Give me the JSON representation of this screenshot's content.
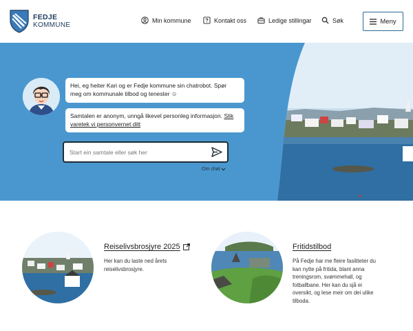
{
  "header": {
    "logo_name": "FEDJE",
    "logo_sub": "KOMMUNE",
    "nav": [
      {
        "label": "Min kommune",
        "icon": "user-circle-icon"
      },
      {
        "label": "Kontakt oss",
        "icon": "question-square-icon"
      },
      {
        "label": "Ledige stillingar",
        "icon": "briefcase-icon"
      },
      {
        "label": "Søk",
        "icon": "search-icon"
      }
    ],
    "menu_label": "Meny"
  },
  "chat": {
    "message_1": "Hei, eg heiter Kari og er Fedje kommune sin chatrobot. Spør meg om kommunale tilbod og tenester ☺",
    "message_2_text": "Samtalen er anonym, unngå likevel personleg informasjon. ",
    "message_2_link": "Slik varetek vi personvernet ditt",
    "input_placeholder": "Start ein samtale eller søk her",
    "about_label": "Om chat"
  },
  "cards": [
    {
      "title": "Reiselivsbrosjyre 2025",
      "external": true,
      "description": "Her kan du laste ned årets reiselivsbrosjyre."
    },
    {
      "title": "Fritidstilbod",
      "external": false,
      "description": "På Fedje har me fleire fasiliteter du kan nytte på fritida, blant anna treningsrom, svømmehall, og fotballbane. Her kan du sjå ei oversikt, og lese meir om dei ulike tilboda."
    }
  ],
  "colors": {
    "hero_bg": "#4a97cf",
    "brand_dark": "#1b3a5c",
    "menu_border": "#2b6a93"
  }
}
